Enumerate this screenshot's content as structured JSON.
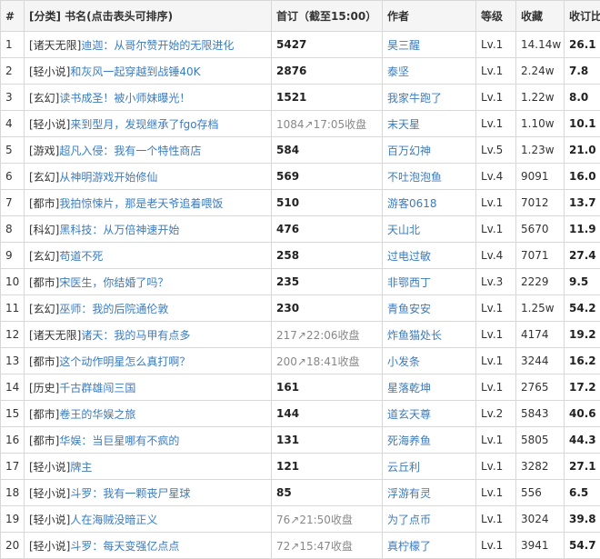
{
  "header": {
    "idx": "#",
    "title": "[分类] 书名(点击表头可排序)",
    "sub": "首订（截至15:00）",
    "author": "作者",
    "level": "等级",
    "fav": "收藏",
    "ratio": "收订比"
  },
  "rows": [
    {
      "idx": "1",
      "cat": "[诸天无限]",
      "name": "迪迦：从哥尔赞开始的无限进化",
      "sub": "5427",
      "sub_bold": true,
      "author": "昊三醒",
      "level": "Lv.1",
      "fav": "14.14w",
      "ratio": "26.1"
    },
    {
      "idx": "2",
      "cat": "[轻小说]",
      "name": "和灰风一起穿越到战锤40K",
      "sub": "2876",
      "sub_bold": true,
      "author": "泰坚",
      "level": "Lv.1",
      "fav": "2.24w",
      "ratio": "7.8"
    },
    {
      "idx": "3",
      "cat": "[玄幻]",
      "name": "读书成圣！被小师妹曝光！",
      "sub": "1521",
      "sub_bold": true,
      "author": "我家牛跑了",
      "level": "Lv.1",
      "fav": "1.22w",
      "ratio": "8.0"
    },
    {
      "idx": "4",
      "cat": "[轻小说]",
      "name": "来到型月，发现继承了fgo存档",
      "sub": "1084↗17:05收盘",
      "sub_bold": false,
      "author": "末天星",
      "level": "Lv.1",
      "fav": "1.10w",
      "ratio": "10.1"
    },
    {
      "idx": "5",
      "cat": "[游戏]",
      "name": "超凡入侵：我有一个特性商店",
      "sub": "584",
      "sub_bold": true,
      "author": "百万幻神",
      "level": "Lv.5",
      "fav": "1.23w",
      "ratio": "21.0"
    },
    {
      "idx": "6",
      "cat": "[玄幻]",
      "name": "从神明游戏开始修仙",
      "sub": "569",
      "sub_bold": true,
      "author": "不吐泡泡鱼",
      "level": "Lv.4",
      "fav": "9091",
      "ratio": "16.0"
    },
    {
      "idx": "7",
      "cat": "[都市]",
      "name": "我拍惊悚片，那是老天爷追着喂饭",
      "sub": "510",
      "sub_bold": true,
      "author": "游客0618",
      "level": "Lv.1",
      "fav": "7012",
      "ratio": "13.7"
    },
    {
      "idx": "8",
      "cat": "[科幻]",
      "name": "黑科技：从万倍神速开始",
      "sub": "476",
      "sub_bold": true,
      "author": "天山北",
      "level": "Lv.1",
      "fav": "5670",
      "ratio": "11.9"
    },
    {
      "idx": "9",
      "cat": "[玄幻]",
      "name": "苟道不死",
      "sub": "258",
      "sub_bold": true,
      "author": "过电过敏",
      "level": "Lv.4",
      "fav": "7071",
      "ratio": "27.4"
    },
    {
      "idx": "10",
      "cat": "[都市]",
      "name": "宋医生，你结婚了吗？",
      "sub": "235",
      "sub_bold": true,
      "author": "非鄂西丁",
      "level": "Lv.3",
      "fav": "2229",
      "ratio": "9.5"
    },
    {
      "idx": "11",
      "cat": "[玄幻]",
      "name": "巫师：我的后院通伦敦",
      "sub": "230",
      "sub_bold": true,
      "author": "青鱼安安",
      "level": "Lv.1",
      "fav": "1.25w",
      "ratio": "54.2"
    },
    {
      "idx": "12",
      "cat": "[诸天无限]",
      "name": "诸天：我的马甲有点多",
      "sub": "217↗22:06收盘",
      "sub_bold": false,
      "author": "炸鱼猫处长",
      "level": "Lv.1",
      "fav": "4174",
      "ratio": "19.2"
    },
    {
      "idx": "13",
      "cat": "[都市]",
      "name": "这个动作明星怎么真打啊？",
      "sub": "200↗18:41收盘",
      "sub_bold": false,
      "author": "小发条",
      "level": "Lv.1",
      "fav": "3244",
      "ratio": "16.2"
    },
    {
      "idx": "14",
      "cat": "[历史]",
      "name": "千古群雄闯三国",
      "sub": "161",
      "sub_bold": true,
      "author": "星落乾坤",
      "level": "Lv.1",
      "fav": "2765",
      "ratio": "17.2"
    },
    {
      "idx": "15",
      "cat": "[都市]",
      "name": "卷王的华娱之旅",
      "sub": "144",
      "sub_bold": true,
      "author": "道玄天尊",
      "level": "Lv.2",
      "fav": "5843",
      "ratio": "40.6"
    },
    {
      "idx": "16",
      "cat": "[都市]",
      "name": "华娱：当巨星哪有不疯的",
      "sub": "131",
      "sub_bold": true,
      "author": "死海养鱼",
      "level": "Lv.1",
      "fav": "5805",
      "ratio": "44.3"
    },
    {
      "idx": "17",
      "cat": "[轻小说]",
      "name": "牌主",
      "sub": "121",
      "sub_bold": true,
      "author": "云丘利",
      "level": "Lv.1",
      "fav": "3282",
      "ratio": "27.1"
    },
    {
      "idx": "18",
      "cat": "[轻小说]",
      "name": "斗罗：我有一颗丧尸星球",
      "sub": "85",
      "sub_bold": true,
      "author": "浮游有灵",
      "level": "Lv.1",
      "fav": "556",
      "ratio": "6.5"
    },
    {
      "idx": "19",
      "cat": "[轻小说]",
      "name": "人在海贼没暗正义",
      "sub": "76↗21:50收盘",
      "sub_bold": false,
      "author": "为了点币",
      "level": "Lv.1",
      "fav": "3024",
      "ratio": "39.8"
    },
    {
      "idx": "20",
      "cat": "[轻小说]",
      "name": "斗罗：每天变强亿点点",
      "sub": "72↗15:47收盘",
      "sub_bold": false,
      "author": "真柠檬了",
      "level": "Lv.1",
      "fav": "3941",
      "ratio": "54.7"
    }
  ]
}
